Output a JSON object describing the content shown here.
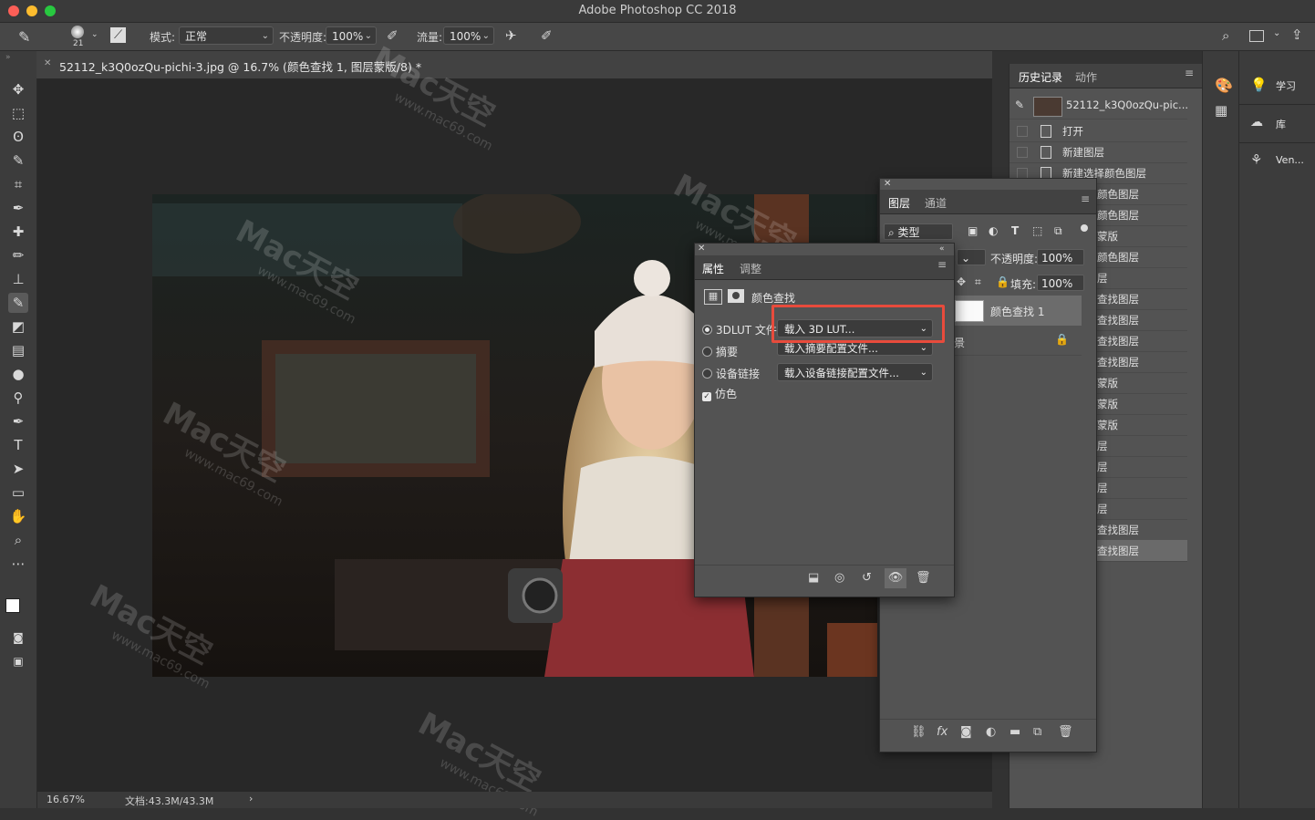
{
  "app": {
    "title": "Adobe Photoshop CC 2018"
  },
  "options_bar": {
    "brush_size": "21",
    "mode_label": "模式:",
    "mode_value": "正常",
    "opacity_label": "不透明度:",
    "opacity_value": "100%",
    "flow_label": "流量:",
    "flow_value": "100%"
  },
  "document_tab": {
    "title": "52112_k3Q0ozQu-pichi-3.jpg @ 16.7% (颜色查找 1, 图层蒙版/8) *"
  },
  "status_bar": {
    "zoom": "16.67%",
    "doc_size": "文档:43.3M/43.3M"
  },
  "history_panel": {
    "tabs": [
      "历史记录",
      "动作"
    ],
    "snapshot": "52112_k3Q0ozQu-pic...",
    "items": [
      "打开",
      "新建图层",
      "新建选择颜色图层",
      "颜色图层",
      "颜色图层",
      "蒙版",
      "颜色图层",
      "层",
      "查找图层",
      "查找图层",
      "查找图层",
      "查找图层",
      "蒙版",
      "蒙版",
      "蒙版",
      "层",
      "层",
      "层",
      "层",
      "查找图层",
      "查找图层"
    ]
  },
  "layers_panel": {
    "tabs": [
      "图层",
      "通道"
    ],
    "filter_label": "类型",
    "opacity_label": "不透明度:",
    "opacity_value": "100%",
    "fill_label": "填充:",
    "fill_value": "100%",
    "layer_name": "颜色查找 1",
    "background_label": "景"
  },
  "properties_panel": {
    "tabs": [
      "属性",
      "调整"
    ],
    "adjustment_title": "颜色查找",
    "rows": [
      {
        "label": "3DLUT 文件",
        "value": "载入 3D LUT..."
      },
      {
        "label": "摘要",
        "value": "载入摘要配置文件..."
      },
      {
        "label": "设备链接",
        "value": "载入设备链接配置文件..."
      }
    ],
    "dither_label": "仿色"
  },
  "right_dock": {
    "learn": "学习",
    "libraries": "库",
    "vendor": "Ven..."
  },
  "watermark": {
    "brand": "Mac天空",
    "url": "www.mac69.com"
  },
  "colors": {
    "highlight": "#e84b3c",
    "panel_bg": "#535353",
    "canvas_bg": "#282828"
  }
}
